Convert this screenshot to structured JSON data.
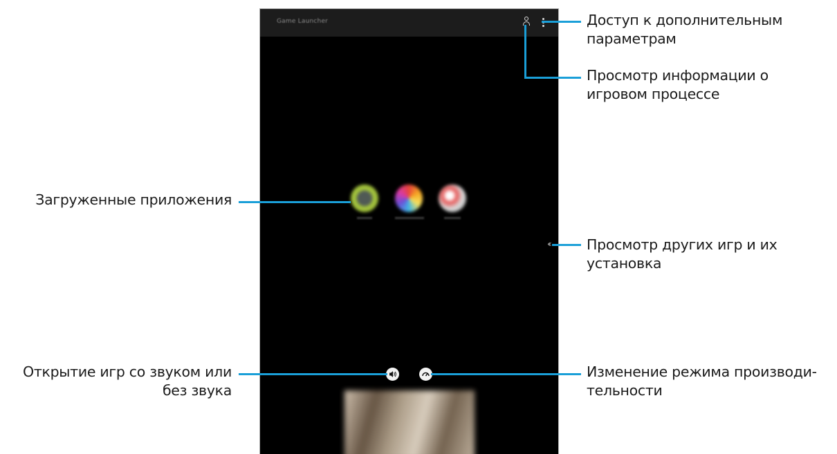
{
  "screen": {
    "app_title": "Game Launcher",
    "left_chevron": "‹‹",
    "sound_button_icon": "speaker-icon",
    "performance_button_icon": "performance-icon"
  },
  "annotations": {
    "additional_options": [
      "Доступ к дополнительным",
      "параметрам"
    ],
    "gameplay_info": [
      "Просмотр информации о",
      "игровом процессе"
    ],
    "downloaded_apps": "Загруженные приложения",
    "more_games": [
      "Просмотр других игр и их",
      "установка"
    ],
    "sound_toggle": [
      "Открытие игр со звуком или",
      "без звука"
    ],
    "performance_mode": [
      "Изменение режима производи-",
      "тельности"
    ]
  },
  "colors": {
    "callout_line": "#1a9fd8",
    "screen_bg": "#000000",
    "appbar_bg": "#1c1c1c"
  }
}
